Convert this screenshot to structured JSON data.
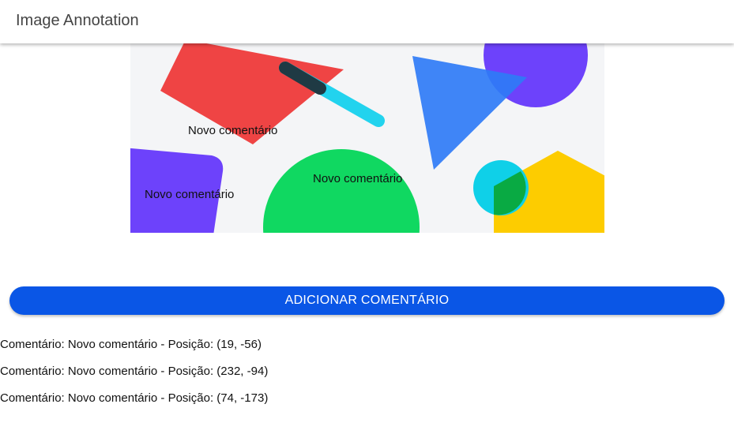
{
  "header": {
    "title": "Image Annotation"
  },
  "image": {
    "shapes": [
      {
        "name": "red-diamond-shape",
        "color": "#ef4444"
      },
      {
        "name": "dark-bar-shape",
        "color": "#1f3a44"
      },
      {
        "name": "cyan-bar-shape",
        "color": "#22d3ee"
      },
      {
        "name": "blue-triangle-shape",
        "color": "#3b82f6"
      },
      {
        "name": "purple-circle-shape",
        "color": "#6d42fb"
      },
      {
        "name": "purple-rounded-shape",
        "color": "#6d42fb"
      },
      {
        "name": "green-semicircle-shape",
        "color": "#10d861"
      },
      {
        "name": "yellow-pentagon-shape",
        "color": "#fdcc00"
      },
      {
        "name": "cyan-circle-shape",
        "color": "#0fd0e8"
      }
    ],
    "annotations": [
      {
        "label": "Novo comentário"
      },
      {
        "label": "Novo comentário"
      },
      {
        "label": "Novo comentário"
      }
    ]
  },
  "actions": {
    "add_comment_label": "ADICIONAR COMENTÁRIO"
  },
  "comments": [
    {
      "text": "Comentário: Novo comentário - Posição: (19, -56)"
    },
    {
      "text": "Comentário: Novo comentário - Posição: (232, -94)"
    },
    {
      "text": "Comentário: Novo comentário - Posição: (74, -173)"
    }
  ],
  "colors": {
    "accent": "#0a56e6",
    "canvas_background": "#f4f5f7"
  }
}
